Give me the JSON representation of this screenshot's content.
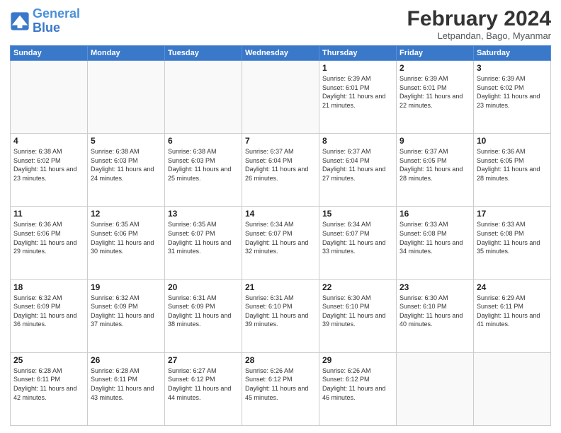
{
  "logo": {
    "line1": "General",
    "line2": "Blue"
  },
  "title": {
    "month_year": "February 2024",
    "location": "Letpandan, Bago, Myanmar"
  },
  "weekdays": [
    "Sunday",
    "Monday",
    "Tuesday",
    "Wednesday",
    "Thursday",
    "Friday",
    "Saturday"
  ],
  "weeks": [
    [
      {
        "day": "",
        "sunrise": "",
        "sunset": "",
        "daylight": ""
      },
      {
        "day": "",
        "sunrise": "",
        "sunset": "",
        "daylight": ""
      },
      {
        "day": "",
        "sunrise": "",
        "sunset": "",
        "daylight": ""
      },
      {
        "day": "",
        "sunrise": "",
        "sunset": "",
        "daylight": ""
      },
      {
        "day": "1",
        "sunrise": "Sunrise: 6:39 AM",
        "sunset": "Sunset: 6:01 PM",
        "daylight": "Daylight: 11 hours and 21 minutes."
      },
      {
        "day": "2",
        "sunrise": "Sunrise: 6:39 AM",
        "sunset": "Sunset: 6:01 PM",
        "daylight": "Daylight: 11 hours and 22 minutes."
      },
      {
        "day": "3",
        "sunrise": "Sunrise: 6:39 AM",
        "sunset": "Sunset: 6:02 PM",
        "daylight": "Daylight: 11 hours and 23 minutes."
      }
    ],
    [
      {
        "day": "4",
        "sunrise": "Sunrise: 6:38 AM",
        "sunset": "Sunset: 6:02 PM",
        "daylight": "Daylight: 11 hours and 23 minutes."
      },
      {
        "day": "5",
        "sunrise": "Sunrise: 6:38 AM",
        "sunset": "Sunset: 6:03 PM",
        "daylight": "Daylight: 11 hours and 24 minutes."
      },
      {
        "day": "6",
        "sunrise": "Sunrise: 6:38 AM",
        "sunset": "Sunset: 6:03 PM",
        "daylight": "Daylight: 11 hours and 25 minutes."
      },
      {
        "day": "7",
        "sunrise": "Sunrise: 6:37 AM",
        "sunset": "Sunset: 6:04 PM",
        "daylight": "Daylight: 11 hours and 26 minutes."
      },
      {
        "day": "8",
        "sunrise": "Sunrise: 6:37 AM",
        "sunset": "Sunset: 6:04 PM",
        "daylight": "Daylight: 11 hours and 27 minutes."
      },
      {
        "day": "9",
        "sunrise": "Sunrise: 6:37 AM",
        "sunset": "Sunset: 6:05 PM",
        "daylight": "Daylight: 11 hours and 28 minutes."
      },
      {
        "day": "10",
        "sunrise": "Sunrise: 6:36 AM",
        "sunset": "Sunset: 6:05 PM",
        "daylight": "Daylight: 11 hours and 28 minutes."
      }
    ],
    [
      {
        "day": "11",
        "sunrise": "Sunrise: 6:36 AM",
        "sunset": "Sunset: 6:06 PM",
        "daylight": "Daylight: 11 hours and 29 minutes."
      },
      {
        "day": "12",
        "sunrise": "Sunrise: 6:35 AM",
        "sunset": "Sunset: 6:06 PM",
        "daylight": "Daylight: 11 hours and 30 minutes."
      },
      {
        "day": "13",
        "sunrise": "Sunrise: 6:35 AM",
        "sunset": "Sunset: 6:07 PM",
        "daylight": "Daylight: 11 hours and 31 minutes."
      },
      {
        "day": "14",
        "sunrise": "Sunrise: 6:34 AM",
        "sunset": "Sunset: 6:07 PM",
        "daylight": "Daylight: 11 hours and 32 minutes."
      },
      {
        "day": "15",
        "sunrise": "Sunrise: 6:34 AM",
        "sunset": "Sunset: 6:07 PM",
        "daylight": "Daylight: 11 hours and 33 minutes."
      },
      {
        "day": "16",
        "sunrise": "Sunrise: 6:33 AM",
        "sunset": "Sunset: 6:08 PM",
        "daylight": "Daylight: 11 hours and 34 minutes."
      },
      {
        "day": "17",
        "sunrise": "Sunrise: 6:33 AM",
        "sunset": "Sunset: 6:08 PM",
        "daylight": "Daylight: 11 hours and 35 minutes."
      }
    ],
    [
      {
        "day": "18",
        "sunrise": "Sunrise: 6:32 AM",
        "sunset": "Sunset: 6:09 PM",
        "daylight": "Daylight: 11 hours and 36 minutes."
      },
      {
        "day": "19",
        "sunrise": "Sunrise: 6:32 AM",
        "sunset": "Sunset: 6:09 PM",
        "daylight": "Daylight: 11 hours and 37 minutes."
      },
      {
        "day": "20",
        "sunrise": "Sunrise: 6:31 AM",
        "sunset": "Sunset: 6:09 PM",
        "daylight": "Daylight: 11 hours and 38 minutes."
      },
      {
        "day": "21",
        "sunrise": "Sunrise: 6:31 AM",
        "sunset": "Sunset: 6:10 PM",
        "daylight": "Daylight: 11 hours and 39 minutes."
      },
      {
        "day": "22",
        "sunrise": "Sunrise: 6:30 AM",
        "sunset": "Sunset: 6:10 PM",
        "daylight": "Daylight: 11 hours and 39 minutes."
      },
      {
        "day": "23",
        "sunrise": "Sunrise: 6:30 AM",
        "sunset": "Sunset: 6:10 PM",
        "daylight": "Daylight: 11 hours and 40 minutes."
      },
      {
        "day": "24",
        "sunrise": "Sunrise: 6:29 AM",
        "sunset": "Sunset: 6:11 PM",
        "daylight": "Daylight: 11 hours and 41 minutes."
      }
    ],
    [
      {
        "day": "25",
        "sunrise": "Sunrise: 6:28 AM",
        "sunset": "Sunset: 6:11 PM",
        "daylight": "Daylight: 11 hours and 42 minutes."
      },
      {
        "day": "26",
        "sunrise": "Sunrise: 6:28 AM",
        "sunset": "Sunset: 6:11 PM",
        "daylight": "Daylight: 11 hours and 43 minutes."
      },
      {
        "day": "27",
        "sunrise": "Sunrise: 6:27 AM",
        "sunset": "Sunset: 6:12 PM",
        "daylight": "Daylight: 11 hours and 44 minutes."
      },
      {
        "day": "28",
        "sunrise": "Sunrise: 6:26 AM",
        "sunset": "Sunset: 6:12 PM",
        "daylight": "Daylight: 11 hours and 45 minutes."
      },
      {
        "day": "29",
        "sunrise": "Sunrise: 6:26 AM",
        "sunset": "Sunset: 6:12 PM",
        "daylight": "Daylight: 11 hours and 46 minutes."
      },
      {
        "day": "",
        "sunrise": "",
        "sunset": "",
        "daylight": ""
      },
      {
        "day": "",
        "sunrise": "",
        "sunset": "",
        "daylight": ""
      }
    ]
  ]
}
